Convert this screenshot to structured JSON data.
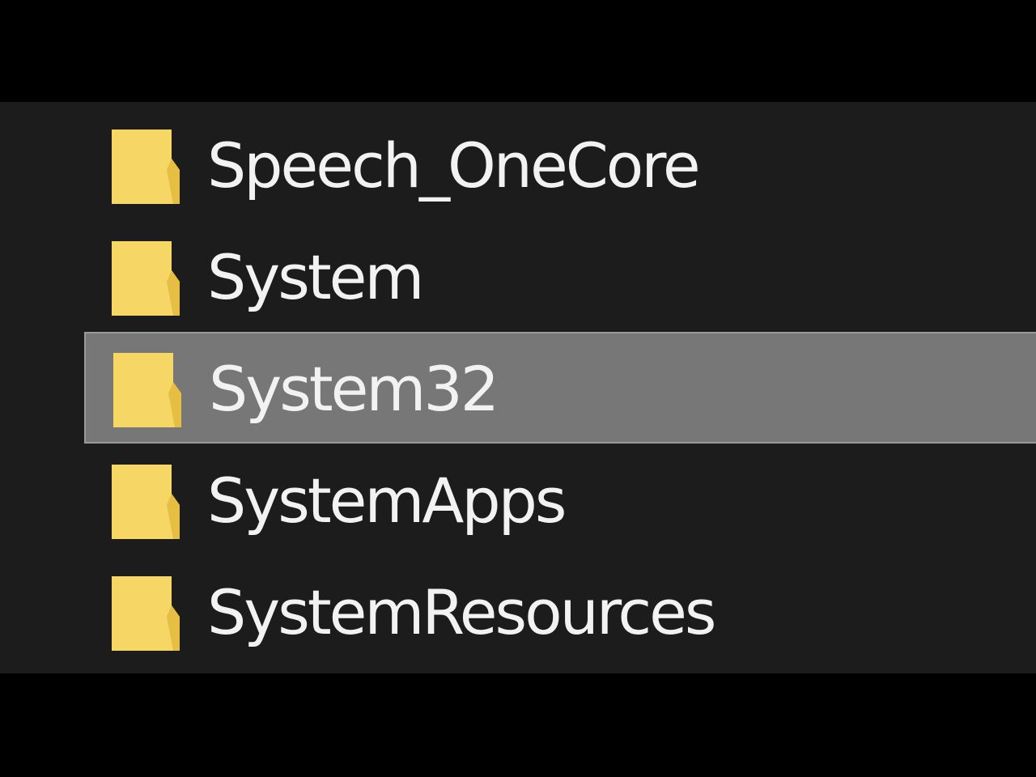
{
  "folders": [
    {
      "name": "Speech_OneCore",
      "icon": "folder-icon",
      "selected": false
    },
    {
      "name": "System",
      "icon": "folder-icon",
      "selected": false
    },
    {
      "name": "System32",
      "icon": "folder-icon",
      "selected": true
    },
    {
      "name": "SystemApps",
      "icon": "folder-icon",
      "selected": false
    },
    {
      "name": "SystemResources",
      "icon": "folder-icon",
      "selected": false
    }
  ],
  "colors": {
    "folder": "#f6d665",
    "folder_shade": "#e6bf42",
    "text": "#f2f2f2",
    "list_background": "#1c1c1c",
    "selection": "#777777"
  }
}
